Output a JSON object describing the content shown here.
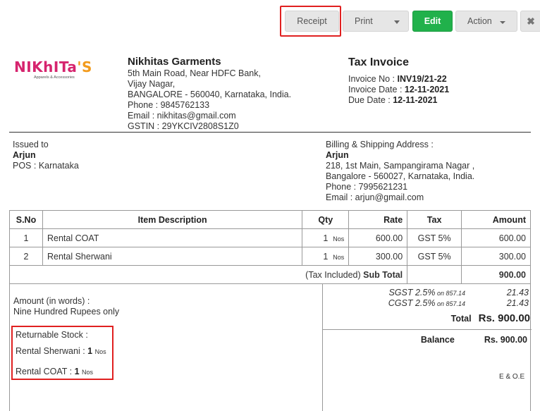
{
  "toolbar": {
    "receipt": "Receipt",
    "print": "Print",
    "edit": "Edit",
    "action": "Action",
    "close": "✖"
  },
  "logo": {
    "text_a": "NIKhITa",
    "text_b": "'S",
    "tagline": "Apparels & Accessories"
  },
  "company": {
    "name": "Nikhitas Garments",
    "line1": "5th Main Road, Near HDFC Bank,",
    "line2": "Vijay Nagar,",
    "line3": "BANGALORE - 560040, Karnataka, India.",
    "phone": "Phone : 9845762133",
    "email": "Email : nikhitas@gmail.com",
    "gstin": "GSTIN : 29YKCIV2808S1Z0"
  },
  "invoice": {
    "title": "Tax Invoice",
    "no_label": "Invoice No  : ",
    "no_value": "INV19/21-22",
    "date_label": "Invoice Date  : ",
    "date_value": "12-11-2021",
    "due_label": "Due Date  : ",
    "due_value": "12-11-2021"
  },
  "issued": {
    "label": "Issued to",
    "name": "Arjun",
    "pos": "POS : Karnataka"
  },
  "billing": {
    "label": "Billing & Shipping Address :",
    "name": "Arjun",
    "line1": "218, 1st Main, Sampangirama Nagar ,",
    "line2": "Bangalore - 560027, Karnataka, India.",
    "phone": "Phone : 7995621231",
    "email": "Email : arjun@gmail.com"
  },
  "table": {
    "headers": {
      "sno": "S.No",
      "desc": "Item Description",
      "qty": "Qty",
      "rate": "Rate",
      "tax": "Tax",
      "amount": "Amount"
    },
    "rows": [
      {
        "sno": "1",
        "desc": "Rental COAT",
        "qty": "1",
        "unit": "Nos",
        "rate": "600.00",
        "tax": "GST 5%",
        "amount": "600.00"
      },
      {
        "sno": "2",
        "desc": "Rental Sherwani",
        "qty": "1",
        "unit": "Nos",
        "rate": "300.00",
        "tax": "GST 5%",
        "amount": "300.00"
      }
    ],
    "subtotal_prefix": "(Tax Included) ",
    "subtotal_label": "Sub Total",
    "subtotal_value": "900.00"
  },
  "footer": {
    "words_label": "Amount (in words) :",
    "words_value": "Nine Hundred Rupees only",
    "stock_title": "Returnable Stock :",
    "stock_items": [
      {
        "name": "Rental Sherwani : ",
        "qty": "1",
        "unit": "Nos"
      },
      {
        "name": "Rental COAT : ",
        "qty": "1",
        "unit": "Nos"
      }
    ],
    "sgst_label": "SGST 2.5%",
    "sgst_on": " on 857.14",
    "sgst_value": "21.43",
    "cgst_label": "CGST 2.5%",
    "cgst_on": " on 857.14",
    "cgst_value": "21.43",
    "total_label": "Total",
    "total_value": "Rs. 900.00",
    "balance_label": "Balance",
    "balance_value": "Rs. 900.00",
    "eoe": "E & O.E"
  },
  "colors": {
    "edit_green": "#21b14b",
    "highlight_red": "#e02020",
    "logo_pink": "#d6246e",
    "logo_orange": "#f29b1d"
  }
}
